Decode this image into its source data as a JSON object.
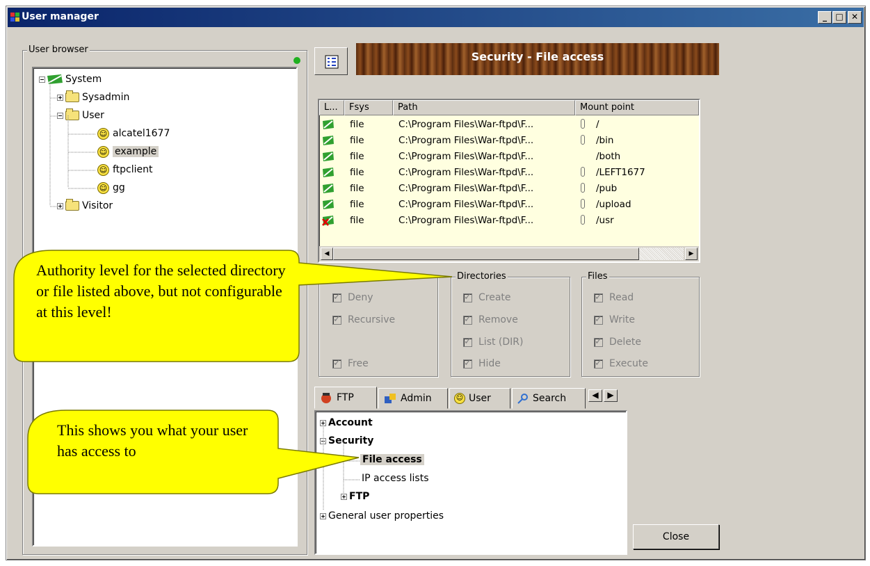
{
  "window": {
    "title": "User manager",
    "controls": [
      "minimize",
      "maximize",
      "close"
    ]
  },
  "user_browser": {
    "label": "User browser",
    "tree": [
      {
        "label": "System",
        "icon": "system-flag-icon",
        "expanded": true
      },
      {
        "label": "Sysadmin",
        "icon": "folder-icon",
        "expanded": false
      },
      {
        "label": "User",
        "icon": "folder-open-icon",
        "expanded": true
      },
      {
        "label": "alcatel1677",
        "icon": "user-smiley-icon"
      },
      {
        "label": "example",
        "icon": "user-smiley-icon",
        "selected": true
      },
      {
        "label": "ftpclient",
        "icon": "user-smiley-icon"
      },
      {
        "label": "gg",
        "icon": "user-smiley-icon"
      },
      {
        "label": "Visitor",
        "icon": "folder-icon",
        "expanded": false
      }
    ]
  },
  "header": {
    "title": "Security - File access"
  },
  "file_list": {
    "columns": [
      "L...",
      "Fsys",
      "Path",
      "Mount point"
    ],
    "rows": [
      {
        "fsys": "file",
        "path": "C:\\Program Files\\War-ftpd\\F...",
        "mount": "/",
        "status": "allowed"
      },
      {
        "fsys": "file",
        "path": "C:\\Program Files\\War-ftpd\\F...",
        "mount": "/bin",
        "status": "allowed"
      },
      {
        "fsys": "file",
        "path": "C:\\Program Files\\War-ftpd\\F...",
        "mount": "/both",
        "status": "allowed"
      },
      {
        "fsys": "file",
        "path": "C:\\Program Files\\War-ftpd\\F...",
        "mount": "/LEFT1677",
        "status": "allowed"
      },
      {
        "fsys": "file",
        "path": "C:\\Program Files\\War-ftpd\\F...",
        "mount": "/pub",
        "status": "allowed"
      },
      {
        "fsys": "file",
        "path": "C:\\Program Files\\War-ftpd\\F...",
        "mount": "/upload",
        "status": "allowed"
      },
      {
        "fsys": "file",
        "path": "C:\\Program Files\\War-ftpd\\F...",
        "mount": "/usr",
        "status": "denied"
      }
    ]
  },
  "permissions": {
    "access": {
      "label": "",
      "items": [
        "Deny",
        "Recursive",
        "Free"
      ]
    },
    "directories": {
      "label": "Directories",
      "items": [
        "Create",
        "Remove",
        "List (DIR)",
        "Hide"
      ]
    },
    "files": {
      "label": "Files",
      "items": [
        "Read",
        "Write",
        "Delete",
        "Execute"
      ]
    }
  },
  "tabs": [
    "FTP",
    "Admin",
    "User",
    "Search"
  ],
  "security_tree": {
    "account": "Account",
    "security": "Security",
    "file_access": "File access",
    "ip_access": "IP access lists",
    "ftp": "FTP",
    "general": "General user properties"
  },
  "callouts": {
    "authority": "Authority level for the selected directory or file listed above, but not configurable at this level!",
    "access": "This shows you what your user has access to"
  },
  "buttons": {
    "close": "Close"
  },
  "colors": {
    "title_bar": "#0a246a",
    "list_bg": "#ffffe0",
    "callout_fill": "#ffff00",
    "window_bg": "#d4d0c8"
  }
}
